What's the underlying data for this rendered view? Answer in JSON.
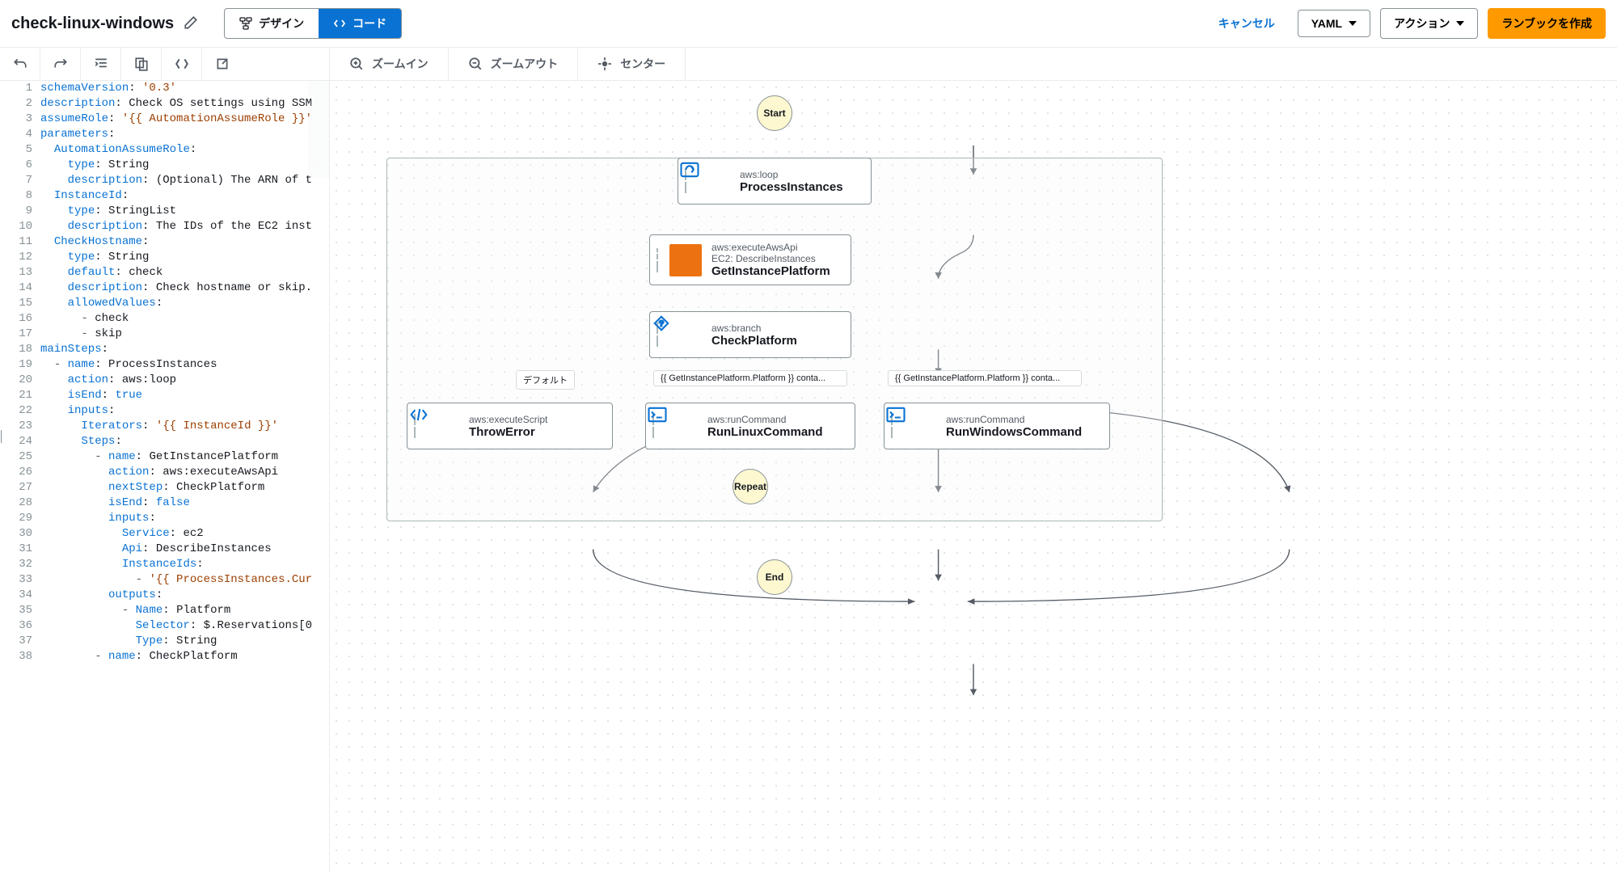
{
  "header": {
    "title": "check-linux-windows",
    "tabs": {
      "design": "デザイン",
      "code": "コード"
    },
    "cancel": "キャンセル",
    "format_selector": "YAML",
    "actions": "アクション",
    "create": "ランブックを作成"
  },
  "canvas_toolbar": {
    "zoom_in": "ズームイン",
    "zoom_out": "ズームアウト",
    "center": "センター"
  },
  "code": [
    [
      [
        "key",
        "schemaVersion"
      ],
      [
        "",
        ": "
      ],
      [
        "str",
        "'0.3'"
      ]
    ],
    [
      [
        "key",
        "description"
      ],
      [
        "",
        ": "
      ],
      [
        "",
        "Check OS settings using SSM"
      ]
    ],
    [
      [
        "key",
        "assumeRole"
      ],
      [
        "",
        ": "
      ],
      [
        "str",
        "'{{ AutomationAssumeRole }}'"
      ]
    ],
    [
      [
        "key",
        "parameters"
      ],
      [
        "",
        ":"
      ]
    ],
    [
      [
        "",
        "  "
      ],
      [
        "key",
        "AutomationAssumeRole"
      ],
      [
        "",
        ":"
      ]
    ],
    [
      [
        "",
        "    "
      ],
      [
        "key",
        "type"
      ],
      [
        "",
        ": "
      ],
      [
        "",
        "String"
      ]
    ],
    [
      [
        "",
        "    "
      ],
      [
        "key",
        "description"
      ],
      [
        "",
        ": "
      ],
      [
        "",
        "(Optional) The ARN of t"
      ]
    ],
    [
      [
        "",
        "  "
      ],
      [
        "key",
        "InstanceId"
      ],
      [
        "",
        ":"
      ]
    ],
    [
      [
        "",
        "    "
      ],
      [
        "key",
        "type"
      ],
      [
        "",
        ": "
      ],
      [
        "",
        "StringList"
      ]
    ],
    [
      [
        "",
        "    "
      ],
      [
        "key",
        "description"
      ],
      [
        "",
        ": "
      ],
      [
        "",
        "The IDs of the EC2 inst"
      ]
    ],
    [
      [
        "",
        "  "
      ],
      [
        "key",
        "CheckHostname"
      ],
      [
        "",
        ":"
      ]
    ],
    [
      [
        "",
        "    "
      ],
      [
        "key",
        "type"
      ],
      [
        "",
        ": "
      ],
      [
        "",
        "String"
      ]
    ],
    [
      [
        "",
        "    "
      ],
      [
        "key",
        "default"
      ],
      [
        "",
        ": "
      ],
      [
        "",
        "check"
      ]
    ],
    [
      [
        "",
        "    "
      ],
      [
        "key",
        "description"
      ],
      [
        "",
        ": "
      ],
      [
        "",
        "Check hostname or skip."
      ]
    ],
    [
      [
        "",
        "    "
      ],
      [
        "key",
        "allowedValues"
      ],
      [
        "",
        ":"
      ]
    ],
    [
      [
        "",
        "      "
      ],
      [
        "dash",
        "- "
      ],
      [
        "",
        "check"
      ]
    ],
    [
      [
        "",
        "      "
      ],
      [
        "dash",
        "- "
      ],
      [
        "",
        "skip"
      ]
    ],
    [
      [
        "key",
        "mainSteps"
      ],
      [
        "",
        ":"
      ]
    ],
    [
      [
        "",
        "  "
      ],
      [
        "dash",
        "- "
      ],
      [
        "key",
        "name"
      ],
      [
        "",
        ": "
      ],
      [
        "",
        "ProcessInstances"
      ]
    ],
    [
      [
        "",
        "    "
      ],
      [
        "key",
        "action"
      ],
      [
        "",
        ": "
      ],
      [
        "",
        "aws:loop"
      ]
    ],
    [
      [
        "",
        "    "
      ],
      [
        "key",
        "isEnd"
      ],
      [
        "",
        ": "
      ],
      [
        "bool",
        "true"
      ]
    ],
    [
      [
        "",
        "    "
      ],
      [
        "key",
        "inputs"
      ],
      [
        "",
        ":"
      ]
    ],
    [
      [
        "",
        "      "
      ],
      [
        "key",
        "Iterators"
      ],
      [
        "",
        ": "
      ],
      [
        "str",
        "'{{ InstanceId }}'"
      ]
    ],
    [
      [
        "",
        "      "
      ],
      [
        "key",
        "Steps"
      ],
      [
        "",
        ":"
      ]
    ],
    [
      [
        "",
        "        "
      ],
      [
        "dash",
        "- "
      ],
      [
        "key",
        "name"
      ],
      [
        "",
        ": "
      ],
      [
        "",
        "GetInstancePlatform"
      ]
    ],
    [
      [
        "",
        "          "
      ],
      [
        "key",
        "action"
      ],
      [
        "",
        ": "
      ],
      [
        "",
        "aws:executeAwsApi"
      ]
    ],
    [
      [
        "",
        "          "
      ],
      [
        "key",
        "nextStep"
      ],
      [
        "",
        ": "
      ],
      [
        "",
        "CheckPlatform"
      ]
    ],
    [
      [
        "",
        "          "
      ],
      [
        "key",
        "isEnd"
      ],
      [
        "",
        ": "
      ],
      [
        "bool",
        "false"
      ]
    ],
    [
      [
        "",
        "          "
      ],
      [
        "key",
        "inputs"
      ],
      [
        "",
        ":"
      ]
    ],
    [
      [
        "",
        "            "
      ],
      [
        "key",
        "Service"
      ],
      [
        "",
        ": "
      ],
      [
        "",
        "ec2"
      ]
    ],
    [
      [
        "",
        "            "
      ],
      [
        "key",
        "Api"
      ],
      [
        "",
        ": "
      ],
      [
        "",
        "DescribeInstances"
      ]
    ],
    [
      [
        "",
        "            "
      ],
      [
        "key",
        "InstanceIds"
      ],
      [
        "",
        ":"
      ]
    ],
    [
      [
        "",
        "              "
      ],
      [
        "dash",
        "- "
      ],
      [
        "str",
        "'{{ ProcessInstances.Cur"
      ]
    ],
    [
      [
        "",
        "          "
      ],
      [
        "key",
        "outputs"
      ],
      [
        "",
        ":"
      ]
    ],
    [
      [
        "",
        "            "
      ],
      [
        "dash",
        "- "
      ],
      [
        "key",
        "Name"
      ],
      [
        "",
        ": "
      ],
      [
        "",
        "Platform"
      ]
    ],
    [
      [
        "",
        "              "
      ],
      [
        "key",
        "Selector"
      ],
      [
        "",
        ": "
      ],
      [
        "",
        "$.Reservations[0"
      ]
    ],
    [
      [
        "",
        "              "
      ],
      [
        "key",
        "Type"
      ],
      [
        "",
        ": "
      ],
      [
        "",
        "String"
      ]
    ],
    [
      [
        "",
        "        "
      ],
      [
        "dash",
        "- "
      ],
      [
        "key",
        "name"
      ],
      [
        "",
        ": "
      ],
      [
        "",
        "CheckPlatform"
      ]
    ]
  ],
  "flow": {
    "start": "Start",
    "end": "End",
    "repeat": "Repeat",
    "edge_default": "デフォルト",
    "edge_cond1": "{{ GetInstancePlatform.Platform }} conta...",
    "edge_cond2": "{{ GetInstancePlatform.Platform }} conta...",
    "nodes": {
      "loop": {
        "sub": "aws:loop",
        "title": "ProcessInstances"
      },
      "api": {
        "sub": "aws:executeAwsApi",
        "sub2": "EC2: DescribeInstances",
        "title": "GetInstancePlatform"
      },
      "branch": {
        "sub": "aws:branch",
        "title": "CheckPlatform"
      },
      "throw": {
        "sub": "aws:executeScript",
        "title": "ThrowError"
      },
      "linux": {
        "sub": "aws:runCommand",
        "title": "RunLinuxCommand"
      },
      "windows": {
        "sub": "aws:runCommand",
        "title": "RunWindowsCommand"
      }
    }
  }
}
